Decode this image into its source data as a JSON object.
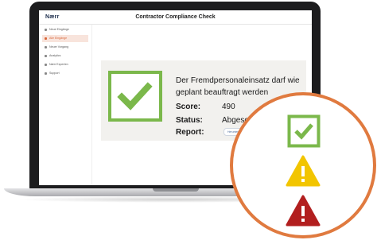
{
  "header": {
    "brand": "Nærr",
    "title": "Contractor Compliance Check"
  },
  "sidebar": {
    "items": [
      {
        "label": "Neue Eingänge",
        "icon": "mail-icon",
        "active": false
      },
      {
        "label": "Alle Eingänge",
        "icon": "inbox-icon",
        "active": true
      },
      {
        "label": "Neuer Vorgang",
        "icon": "plus-icon",
        "active": false
      },
      {
        "label": "Analytics",
        "icon": "chart-icon",
        "active": false
      },
      {
        "label": "Nærr Experten",
        "icon": "people-icon",
        "active": false
      },
      {
        "label": "Support",
        "icon": "help-icon",
        "active": false
      }
    ]
  },
  "result": {
    "message": "Der Fremdpersonaleinsatz darf wie geplant beauftragt werden",
    "score_label": "Score:",
    "score_value": "490",
    "status_label": "Status:",
    "status_value": "Abgeschlossen",
    "report_label": "Report:",
    "report_chip": "Herunterladen"
  },
  "legend_icons": [
    "check-icon",
    "warning-icon",
    "danger-icon"
  ],
  "colors": {
    "accent_orange": "#e07a3f",
    "ok_green": "#7bb84b",
    "warn_yellow": "#f2c500",
    "danger_red": "#b21f1f"
  }
}
